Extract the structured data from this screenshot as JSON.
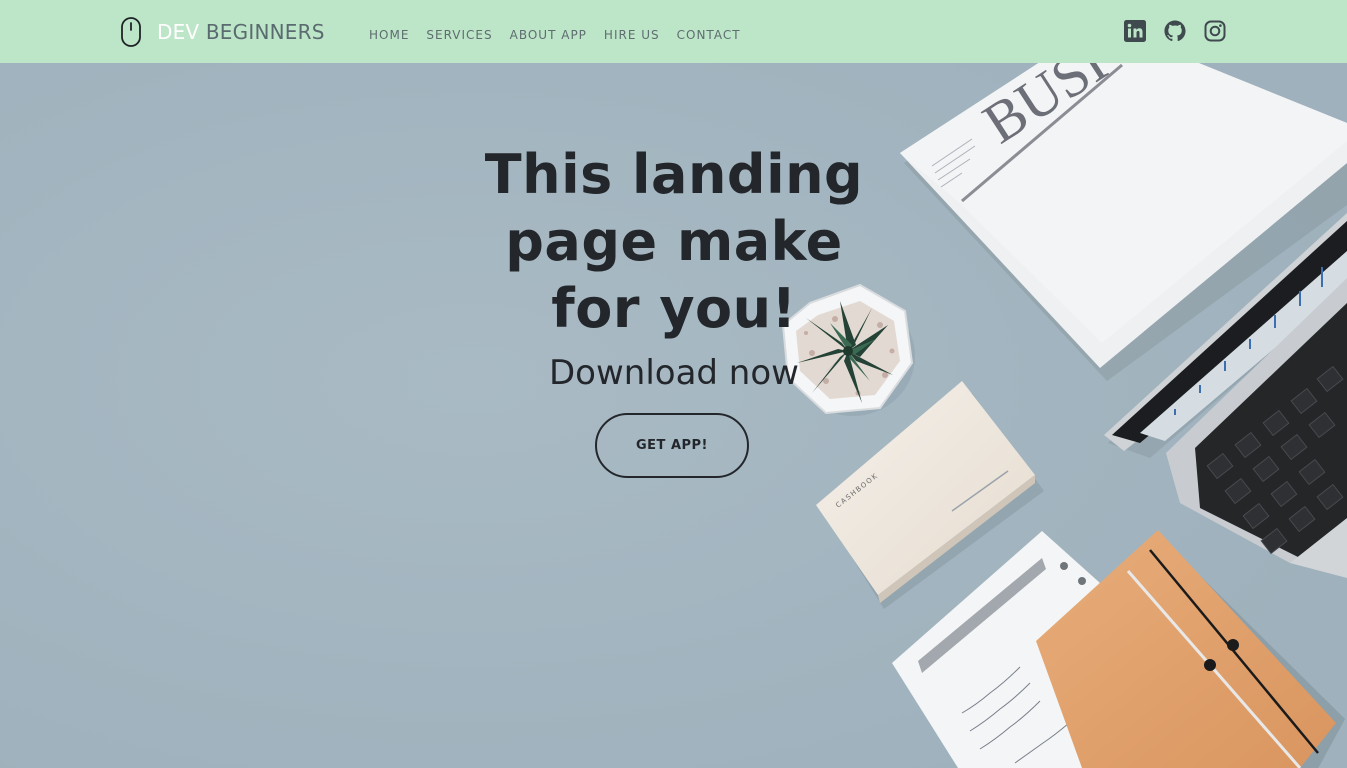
{
  "brand": {
    "prefix": "DEV",
    "name": "BEGINNERS",
    "icon": "mouse-icon"
  },
  "nav": {
    "items": [
      "HOME",
      "SERVICES",
      "ABOUT APP",
      "HIRE US",
      "CONTACT"
    ]
  },
  "socials": [
    {
      "icon": "linkedin-icon"
    },
    {
      "icon": "github-icon"
    },
    {
      "icon": "instagram-icon"
    }
  ],
  "hero": {
    "headline": "This landing page make for you!",
    "subheadline": "Download now",
    "cta_label": "GET APP!",
    "newspaper_heading": "BUSI",
    "notebook_label": "CASHBOOK"
  },
  "colors": {
    "navbar_bg": "#bde5c8",
    "hero_bg": "#a3b5c0",
    "text_dark": "#23272b",
    "nav_text": "#5f6d70"
  }
}
